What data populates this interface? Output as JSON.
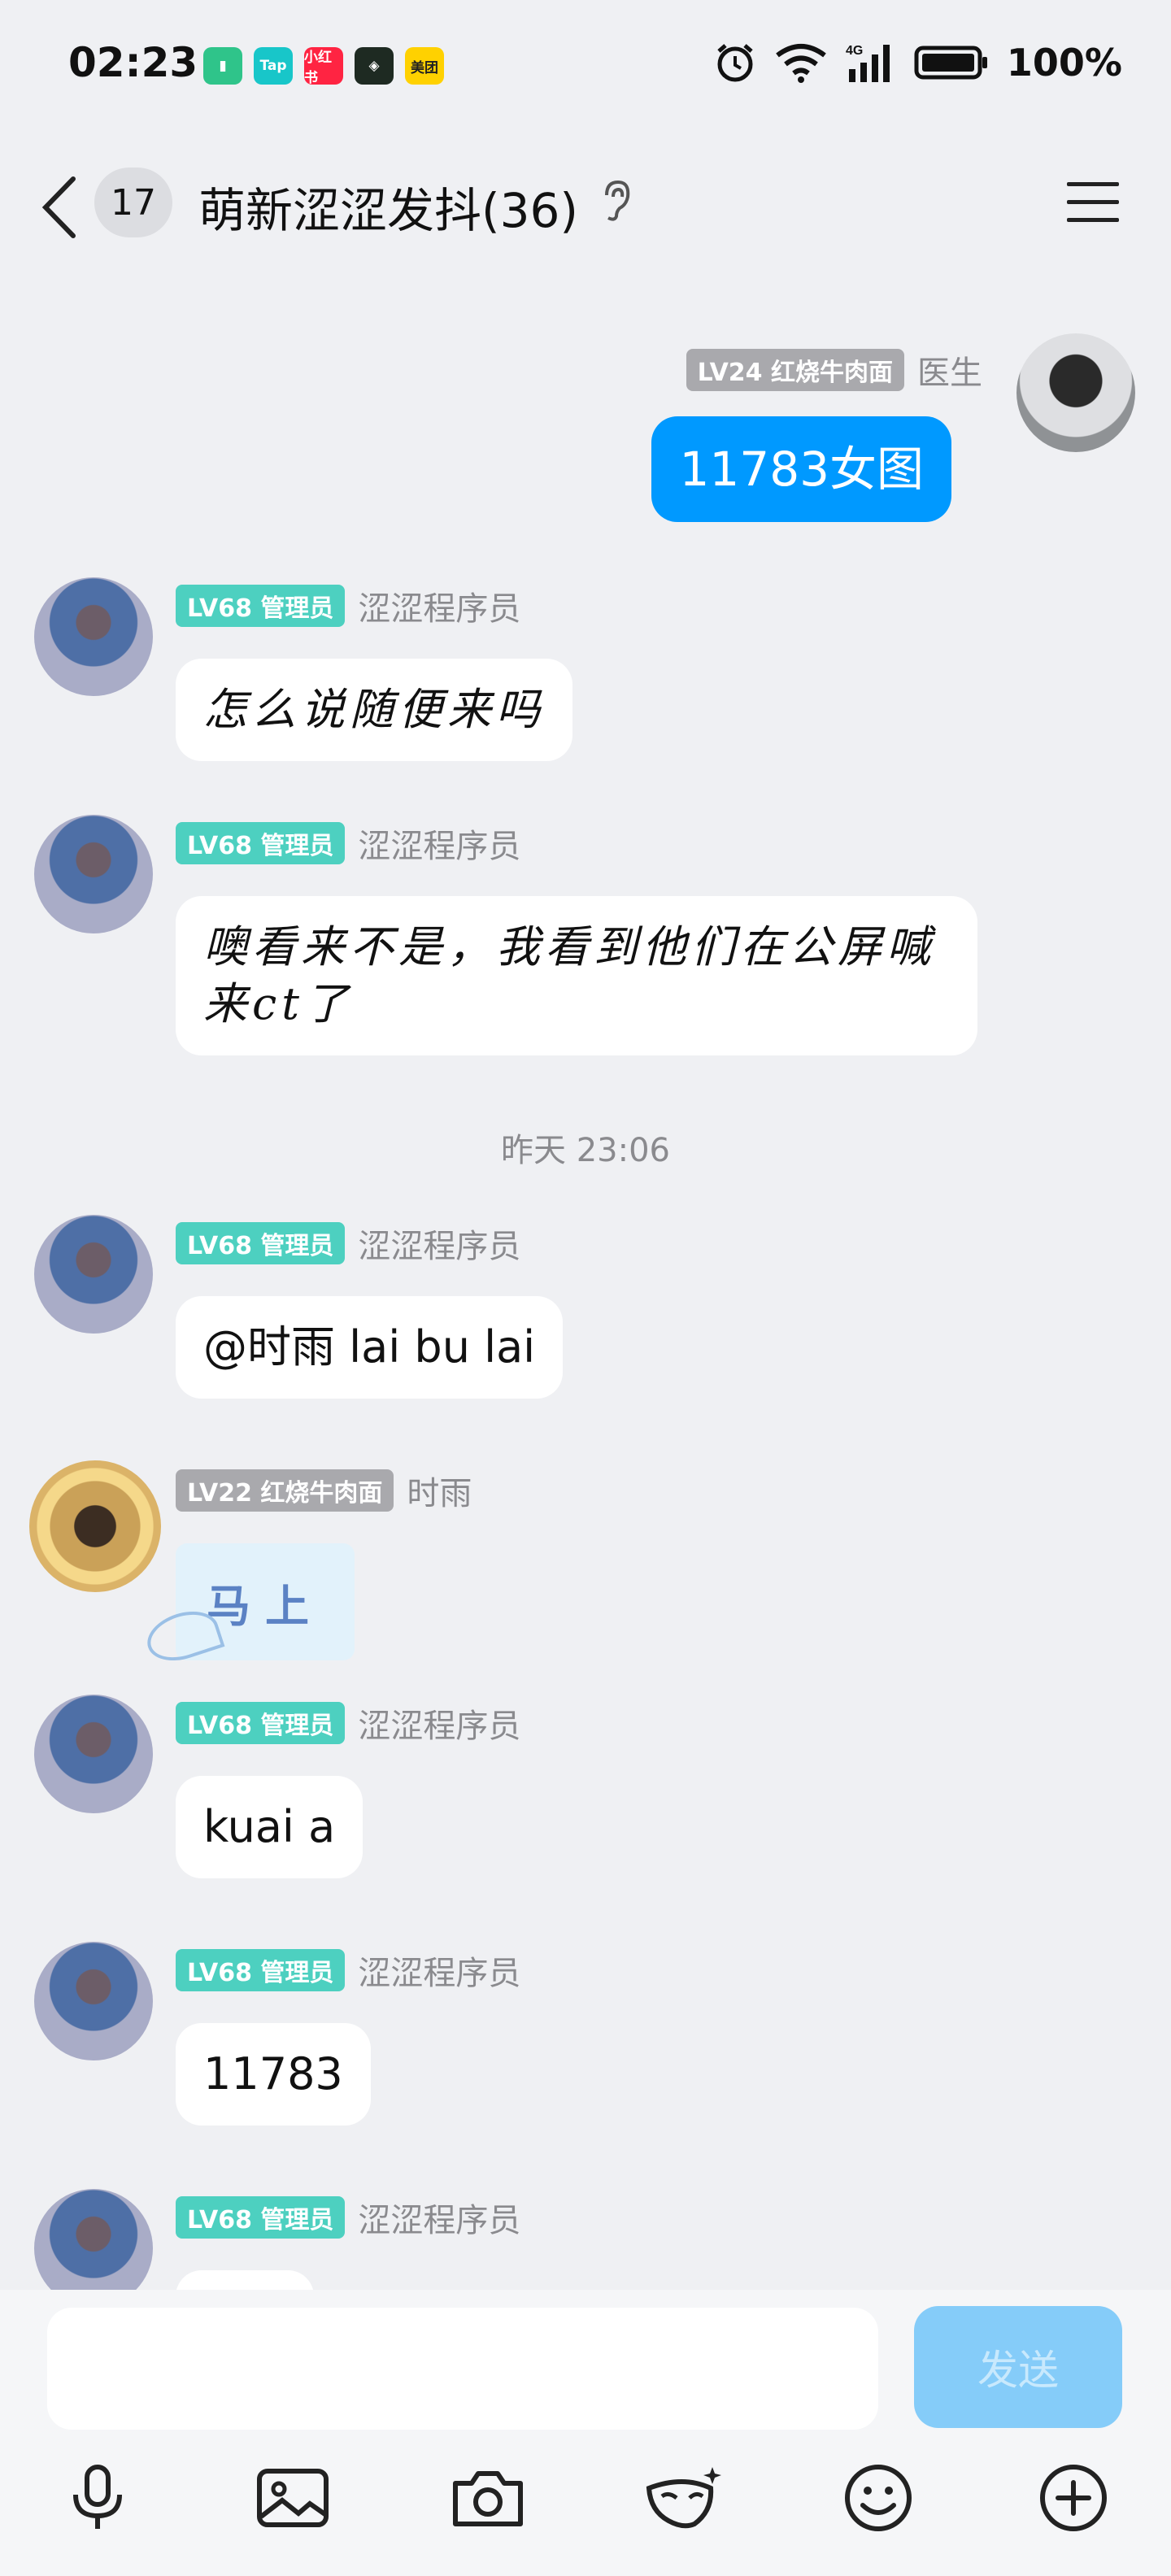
{
  "status_bar": {
    "time": "02:23",
    "apps": [
      {
        "label": "▮",
        "color": "#2fc48a"
      },
      {
        "label": "Tap",
        "color": "#18c6c9"
      },
      {
        "label": "小红书",
        "color": "#ff2442"
      },
      {
        "label": "◈",
        "color": "#1e2a22"
      },
      {
        "label": "美团",
        "color": "#ffd100"
      }
    ],
    "network": "4G",
    "battery": "100%"
  },
  "nav": {
    "unread_count": "17",
    "title": "萌新涩涩发抖(36)"
  },
  "messages": [
    {
      "side": "right",
      "level": "LV24 红烧牛肉面",
      "sender": "医生",
      "text": "11783女图"
    },
    {
      "side": "left",
      "level": "LV68 管理员",
      "sender": "涩涩程序员",
      "text": "怎么说随便来吗"
    },
    {
      "side": "left",
      "level": "LV68 管理员",
      "sender": "涩涩程序员",
      "text_line1": "噢看来不是，我看到他们在公屏喊",
      "text_line2": "来ct了"
    },
    {
      "timestamp": "昨天 23:06"
    },
    {
      "side": "left",
      "level": "LV68 管理员",
      "sender": "涩涩程序员",
      "text": "@时雨 lai bu lai"
    },
    {
      "side": "left",
      "level": "LV22 红烧牛肉面",
      "sender": "时雨",
      "sticker_text": "马上"
    },
    {
      "side": "left",
      "level": "LV68 管理员",
      "sender": "涩涩程序员",
      "text": "kuai a"
    },
    {
      "side": "left",
      "level": "LV68 管理员",
      "sender": "涩涩程序员",
      "text": "11783"
    },
    {
      "side": "left",
      "level": "LV68 管理员",
      "sender": "涩涩程序员",
      "text": ""
    }
  ],
  "input": {
    "placeholder": "",
    "send_label": "发送"
  },
  "colors": {
    "accent": "#0099ff",
    "admin_badge": "#4dd0c0",
    "member_badge": "#a9a9ad",
    "send_disabled": "#85ccf9"
  },
  "toolbar_icons": [
    "mic-icon",
    "image-icon",
    "camera-icon",
    "mask-icon",
    "emoji-icon",
    "plus-icon"
  ]
}
